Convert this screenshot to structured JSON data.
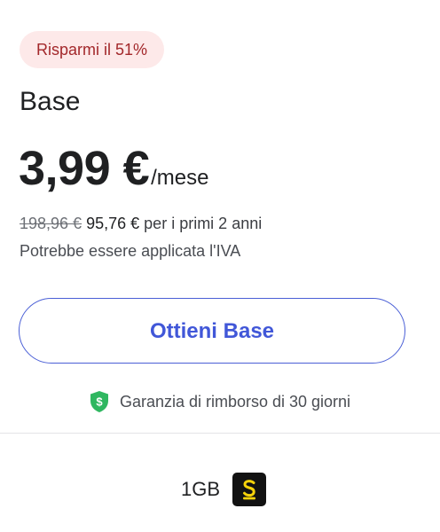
{
  "offer": {
    "discount_badge": "Risparmi il 51%",
    "plan_name": "Base",
    "price": "3,99 €",
    "price_unit": "/mese",
    "old_price": "198,96 €",
    "new_price": "95,76 €",
    "promo_period": "per i primi 2 anni",
    "vat_note": "Potrebbe essere applicata l'IVA",
    "cta_label": "Ottieni Base",
    "guarantee": "Garanzia di rimborso di 30 giorni",
    "guarantee_icon": "shield-dollar-icon",
    "feature_label": "1GB",
    "feature_icon": "app-logo-icon"
  },
  "colors": {
    "accent": "#4157d8",
    "badge_bg": "#fde9e9",
    "badge_text": "#a3282b",
    "shield": "#2fb760",
    "logo_bg": "#121212",
    "logo_fg": "#f5d20a"
  }
}
